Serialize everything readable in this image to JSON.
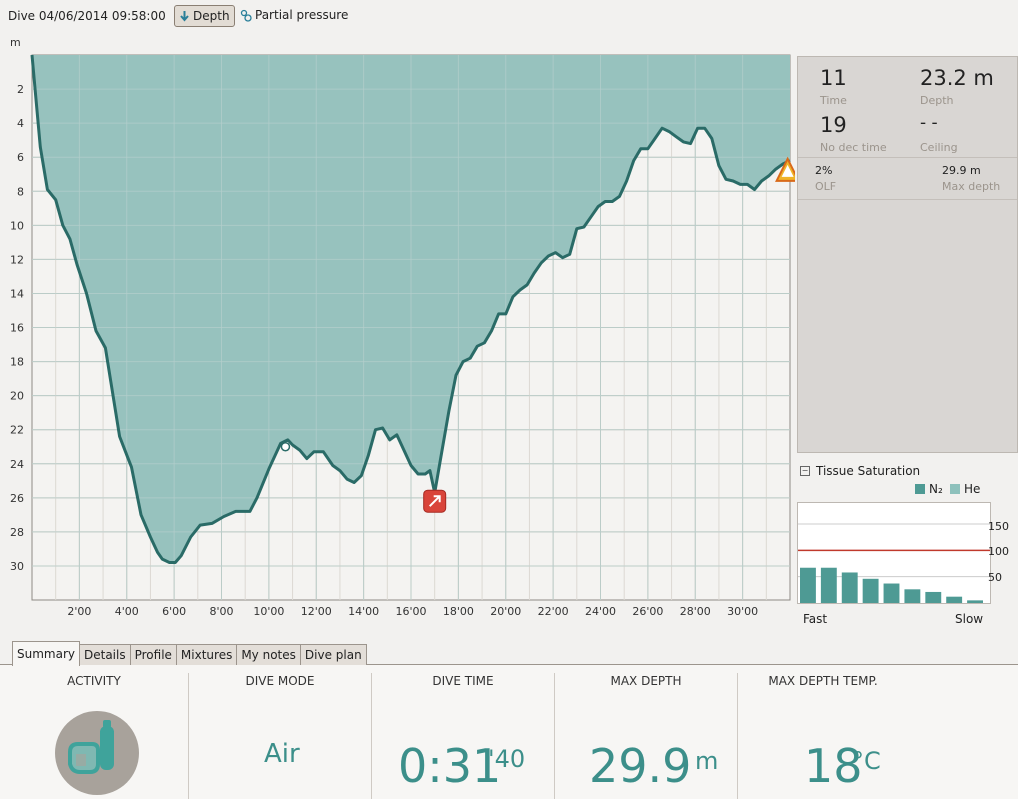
{
  "header": {
    "dive_title": "Dive 04/06/2014 09:58:00",
    "depth_button": "Depth",
    "partial_pressure_button": "Partial pressure"
  },
  "profile": {
    "unit": "m"
  },
  "chart_data": {
    "type": "area",
    "title": "",
    "xlabel": "",
    "ylabel": "m",
    "x_unit": "minutes",
    "xlim": [
      0,
      32
    ],
    "ylim": [
      32,
      0
    ],
    "y_inverted": true,
    "grid": true,
    "x_ticks": [
      "2'00",
      "4'00",
      "6'00",
      "8'00",
      "10'00",
      "12'00",
      "14'00",
      "16'00",
      "18'00",
      "20'00",
      "22'00",
      "24'00",
      "26'00",
      "28'00",
      "30'00"
    ],
    "x_tick_values": [
      2,
      4,
      6,
      8,
      10,
      12,
      14,
      16,
      18,
      20,
      22,
      24,
      26,
      28,
      30
    ],
    "y_ticks": [
      "2",
      "4",
      "6",
      "8",
      "10",
      "12",
      "14",
      "16",
      "18",
      "20",
      "22",
      "24",
      "26",
      "28",
      "30"
    ],
    "y_tick_values": [
      2,
      4,
      6,
      8,
      10,
      12,
      14,
      16,
      18,
      20,
      22,
      24,
      26,
      28,
      30
    ],
    "fill_color": "#97c2be",
    "line_color": "#2a6b67",
    "x": [
      0,
      0.35,
      0.65,
      1,
      1.3,
      1.6,
      1.9,
      2.3,
      2.7,
      3.1,
      3.7,
      4.2,
      4.6,
      5,
      5.3,
      5.5,
      5.8,
      6.05,
      6.3,
      6.7,
      7.1,
      7.6,
      8.1,
      8.6,
      8.9,
      9.2,
      9.5,
      10,
      10.5,
      10.8,
      11,
      11.3,
      11.6,
      11.9,
      12.3,
      12.7,
      13,
      13.3,
      13.6,
      13.9,
      14.2,
      14.5,
      14.8,
      15.1,
      15.4,
      15.7,
      16,
      16.3,
      16.6,
      16.8,
      17,
      17.3,
      17.6,
      17.9,
      18.2,
      18.5,
      18.8,
      19.1,
      19.4,
      19.7,
      20,
      20.3,
      20.6,
      20.9,
      21.2,
      21.5,
      21.8,
      22.1,
      22.4,
      22.7,
      23,
      23.3,
      23.6,
      23.9,
      24.2,
      24.5,
      24.8,
      25.1,
      25.4,
      25.7,
      26,
      26.3,
      26.6,
      26.9,
      27.2,
      27.5,
      27.8,
      28.1,
      28.4,
      28.7,
      29,
      29.3,
      29.6,
      29.9,
      30.2,
      30.5,
      30.8,
      31.1,
      31.4,
      31.7,
      32
    ],
    "y": [
      0,
      5.4,
      7.9,
      8.5,
      10,
      10.8,
      12.3,
      14,
      16.2,
      17.2,
      22.4,
      24.2,
      27,
      28.3,
      29.2,
      29.6,
      29.8,
      29.8,
      29.4,
      28.3,
      27.6,
      27.5,
      27.1,
      26.8,
      26.8,
      26.8,
      26,
      24.3,
      22.8,
      22.6,
      22.9,
      23.2,
      23.7,
      23.3,
      23.3,
      24.1,
      24.4,
      24.9,
      25.1,
      24.7,
      23.5,
      22,
      21.9,
      22.6,
      22.3,
      23.2,
      24.1,
      24.6,
      24.6,
      24.4,
      25.7,
      23.3,
      20.9,
      18.8,
      18,
      17.8,
      17.1,
      16.9,
      16.2,
      15.2,
      15.2,
      14.2,
      13.8,
      13.5,
      12.8,
      12.2,
      11.8,
      11.6,
      11.9,
      11.7,
      10.2,
      10.1,
      9.5,
      8.9,
      8.6,
      8.6,
      8.3,
      7.4,
      6.2,
      5.5,
      5.5,
      4.9,
      4.3,
      4.5,
      4.8,
      5.1,
      5.2,
      4.3,
      4.3,
      4.9,
      6.5,
      7.3,
      7.4,
      7.6,
      7.6,
      7.9,
      7.4,
      7.1,
      6.7,
      6.4,
      6.2
    ],
    "annotations": [
      {
        "x": 10.7,
        "y": 23.0,
        "kind": "gas-change-marker"
      },
      {
        "x": 17.0,
        "y": 26.2,
        "kind": "ascent-warning"
      },
      {
        "x": 31.9,
        "y": 6.8,
        "kind": "warning"
      }
    ]
  },
  "dive_info": {
    "time_value": "11",
    "time_label": "Time",
    "depth_value": "23.2 m",
    "depth_label": "Depth",
    "nodec_value": "19",
    "nodec_label": "No dec time",
    "ceiling_value": "- -",
    "ceiling_label": "Ceiling",
    "olf_value": "2%",
    "olf_label": "OLF",
    "maxdepth_value": "29.9 m",
    "maxdepth_label": "Max depth"
  },
  "tissue": {
    "title": "Tissue Saturation",
    "collapse_symbol": "−",
    "legend_n2": "N₂",
    "legend_he": "He",
    "n2_color": "#4e9a94",
    "he_color": "#8ec1bc",
    "limit_color": "#c0392b",
    "scale_max": 190,
    "limit": 100,
    "ticks": [
      "150",
      "100",
      "50"
    ],
    "tick_values": [
      150,
      100,
      50
    ],
    "bars": [
      67,
      67,
      58,
      46,
      37,
      26,
      21,
      12,
      5
    ],
    "fast_label": "Fast",
    "slow_label": "Slow"
  },
  "tabs": [
    "Summary",
    "Details",
    "Profile",
    "Mixtures",
    "My notes",
    "Dive plan"
  ],
  "active_tab": "Summary",
  "summary": {
    "activity_header": "ACTIVITY",
    "dive_mode_header": "DIVE MODE",
    "dive_mode_value": "Air",
    "dive_time_header": "DIVE TIME",
    "dive_time_main": "0:31",
    "dive_time_sec": "'40",
    "max_depth_header": "MAX DEPTH",
    "max_depth_value": "29.9",
    "max_depth_unit": "m",
    "max_temp_header": "MAX DEPTH TEMP.",
    "max_temp_value": "18",
    "max_temp_unit": "°C"
  }
}
